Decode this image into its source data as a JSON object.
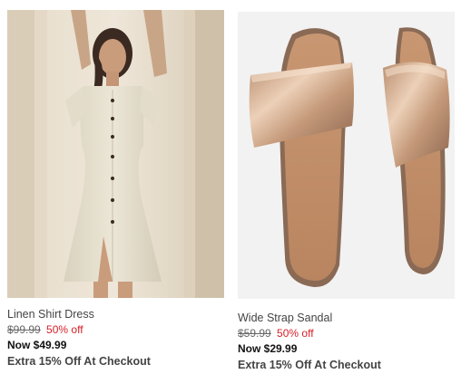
{
  "products": [
    {
      "name": "Linen Shirt Dress",
      "was_price": "$99.99",
      "discount": "50% off",
      "now_price": "Now $49.99",
      "promo": "Extra 15% Off At Checkout"
    },
    {
      "name": "Wide Strap Sandal",
      "was_price": "$59.99",
      "discount": "50% off",
      "now_price": "Now $29.99",
      "promo": "Extra 15% Off At Checkout"
    }
  ],
  "colors": {
    "discount": "#d61f26",
    "text": "#444444",
    "now_price": "#111111"
  }
}
